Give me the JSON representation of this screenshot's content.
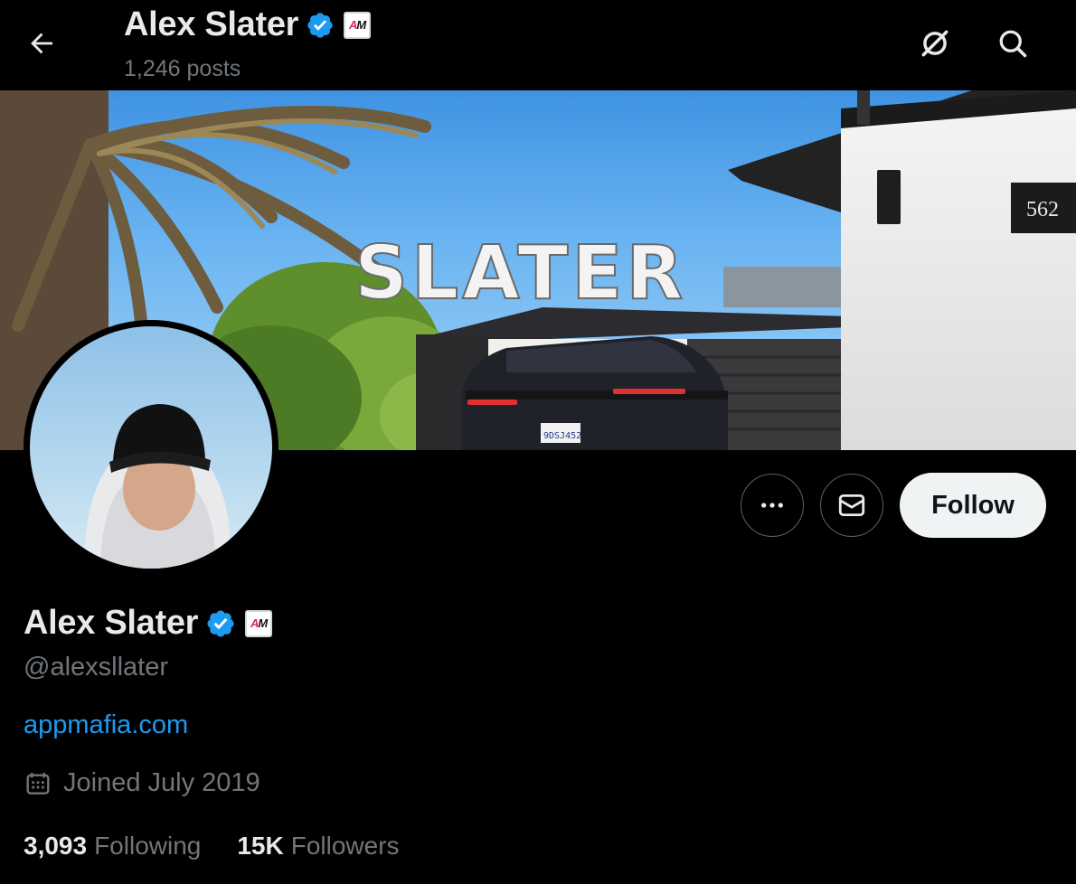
{
  "header": {
    "name": "Alex Slater",
    "posts_count": "1,246 posts",
    "back_icon": "arrow-left-icon",
    "grok_icon": "grok-icon",
    "search_icon": "search-icon"
  },
  "banner": {
    "overlay_text": "SLATER",
    "house_number": "562",
    "license_plate": "9DSJ452"
  },
  "actions": {
    "more_icon": "more-icon",
    "message_icon": "envelope-icon",
    "follow_label": "Follow"
  },
  "profile": {
    "name": "Alex Slater",
    "handle": "@alexsllater",
    "website": "appmafia.com",
    "joined": "Joined July 2019",
    "affiliate_badge": "AM"
  },
  "stats": {
    "following_count": "3,093",
    "following_label": "Following",
    "followers_count": "15K",
    "followers_label": "Followers"
  },
  "colors": {
    "background": "#000000",
    "text_primary": "#e7e9ea",
    "text_secondary": "#71767b",
    "link": "#1d9bf0",
    "verified": "#1d9bf0",
    "follow_bg": "#eff3f4"
  }
}
